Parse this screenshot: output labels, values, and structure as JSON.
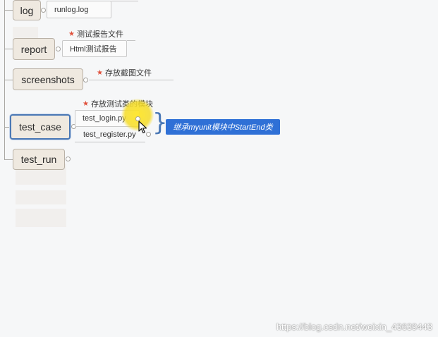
{
  "mindmap": {
    "nodes": [
      {
        "label": "log"
      },
      {
        "label": "report"
      },
      {
        "label": "screenshots"
      },
      {
        "label": "test_case"
      },
      {
        "label": "test_run"
      }
    ],
    "children": {
      "log_file": "runlog.log",
      "report_file": "Html测试报告",
      "test_login": "test_login.py",
      "test_register": "test_register.py"
    },
    "notes": {
      "report": "测试报告文件",
      "screenshots": "存放截图文件",
      "test_case": "存放测试类的模块"
    },
    "callout": "继承myunit模块中StartEnd类",
    "icons": {
      "note_marker": "star-icon",
      "collapse_toggle": "collapse-toggle-icon",
      "pointer": "mouse-pointer-icon"
    }
  },
  "watermark": "https://blog.csdn.net/weixin_43639443",
  "colors": {
    "background": "#f6f7f8",
    "node_fill": "#efe9e0",
    "selected_border": "#4a78b5",
    "callout_bg": "#2f70d6",
    "star": "#e0513c",
    "highlight": "#f5dc28"
  }
}
